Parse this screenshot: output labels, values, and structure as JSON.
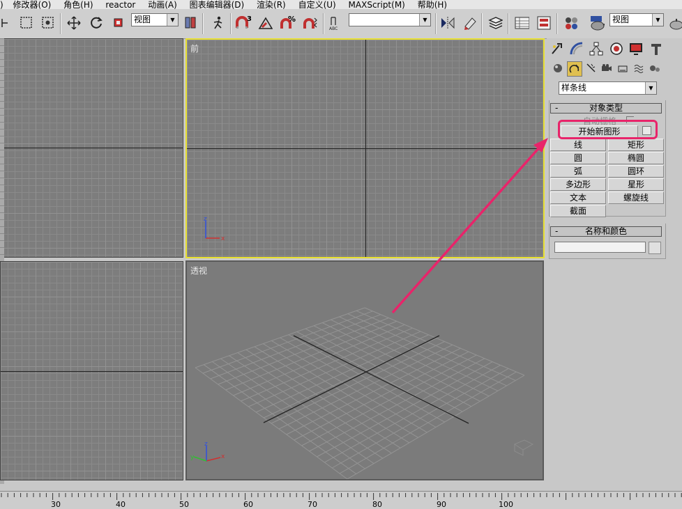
{
  "menu": {
    "items": [
      ")",
      "修改器(O)",
      "角色(H)",
      "reactor",
      "动画(A)",
      "图表编辑器(D)",
      "渲染(R)",
      "自定义(U)",
      "MAXScript(M)",
      "帮助(H)"
    ]
  },
  "toolbar": {
    "view_dropdown_1": "视图",
    "named_selection_dropdown": "",
    "view_dropdown_2": "视图",
    "snap_value": "3",
    "percent_snap_symbol": "%"
  },
  "viewports": {
    "front_label": "前",
    "perspective_label": "透视"
  },
  "command_panel": {
    "shape_category_dropdown": "样条线",
    "object_type": {
      "title": "对象类型",
      "auto_grid_label": "自动栅格",
      "start_new_shape_label": "开始新图形",
      "buttons": [
        "线",
        "矩形",
        "圆",
        "椭圆",
        "弧",
        "圆环",
        "多边形",
        "星形",
        "文本",
        "螺旋线",
        "截面"
      ]
    },
    "name_and_color": {
      "title": "名称和颜色",
      "name_value": ""
    },
    "rollout_minus": "-"
  },
  "colors": {
    "viewport_bg": "#7d7d7d",
    "active_viewport_border": "#e8e030",
    "highlight_annotation": "#e8246a",
    "axis_x": "#d03030",
    "axis_y": "#30c030",
    "axis_z": "#3050e0"
  },
  "timeline": {
    "ruler_numbers": [
      "30",
      "40",
      "50",
      "60",
      "70",
      "80",
      "90",
      "100"
    ]
  }
}
